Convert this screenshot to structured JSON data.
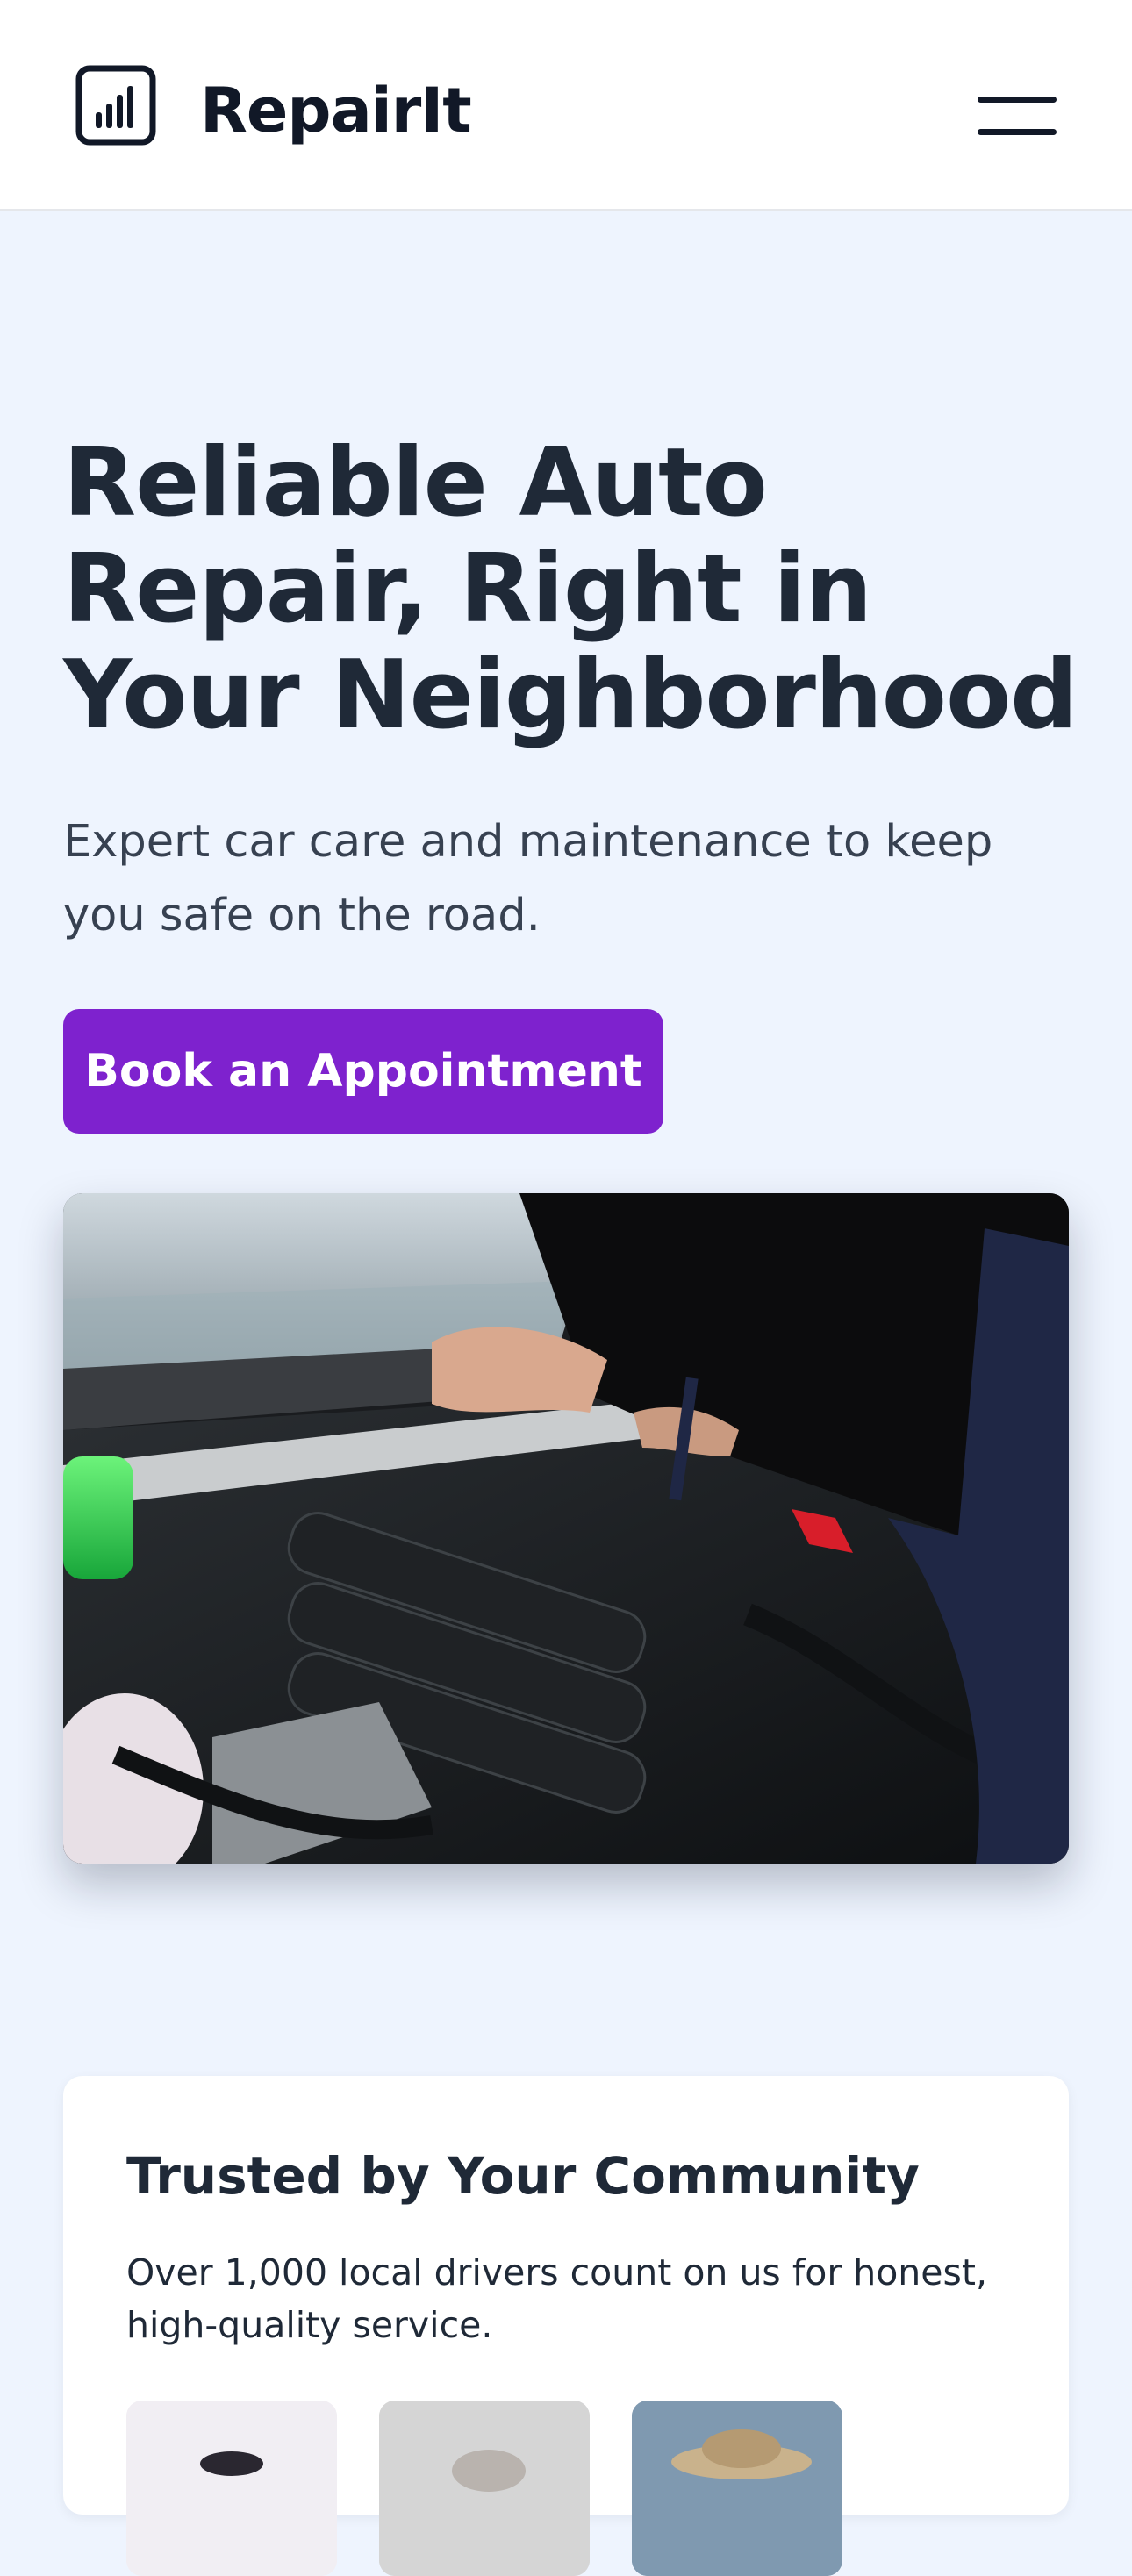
{
  "header": {
    "brand": "RepairIt",
    "logo_icon": "bar-chart-icon",
    "menu_icon": "hamburger-menu-icon"
  },
  "hero": {
    "title": "Reliable Auto Repair, Right in Your Neighborhood",
    "subtitle": "Expert car care and maintenance to keep you safe on the road.",
    "cta_label": "Book an Appointment",
    "image_subject": "mechanic working on car engine"
  },
  "trust": {
    "title": "Trusted by Your Community",
    "text": "Over 1,000 local drivers count on us for honest, high-quality service.",
    "avatars": [
      "customer-avatar",
      "customer-avatar",
      "customer-avatar"
    ]
  },
  "colors": {
    "accent": "#7e22ce",
    "page_background": "#eef4fe",
    "header_background": "#ffffff",
    "text": "#1f2937"
  }
}
